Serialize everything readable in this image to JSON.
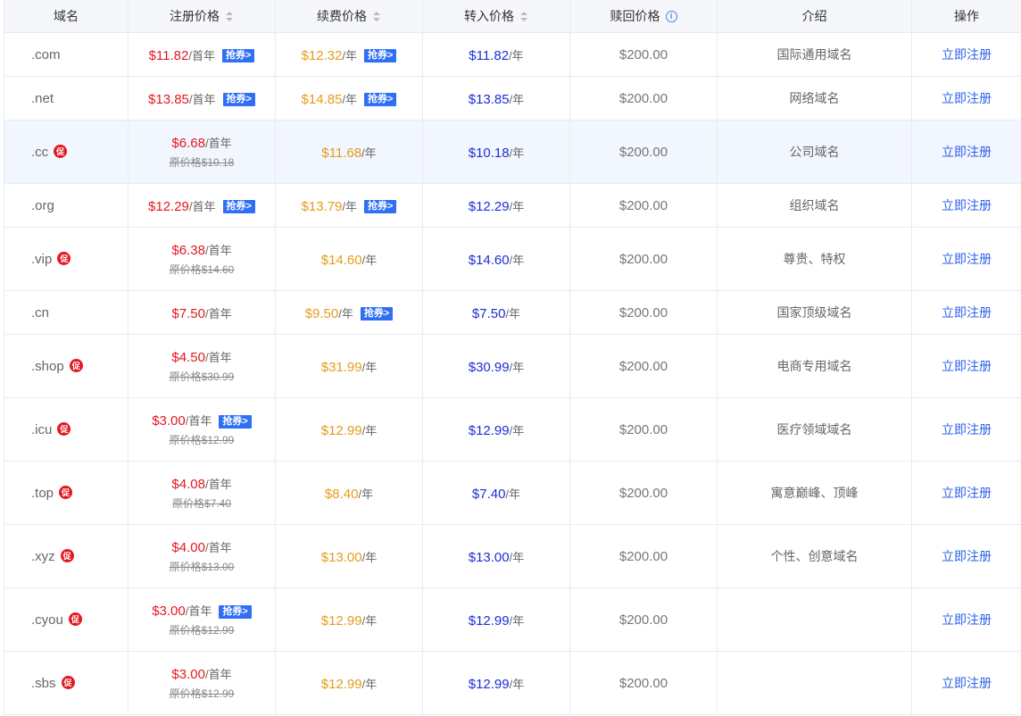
{
  "headers": {
    "domain": "域名",
    "register": "注册价格",
    "renew": "续费价格",
    "transfer": "转入价格",
    "redeem": "赎回价格",
    "intro": "介绍",
    "action": "操作"
  },
  "labels": {
    "first_year": "/首年",
    "per_year": "/年",
    "coupon": "抢券>",
    "promo": "促",
    "action_link": "立即注册"
  },
  "colors": {
    "register_price": "#e4181f",
    "renew_price": "#e69b19",
    "transfer_price": "#1b2fd6",
    "coupon_badge": "#2f6ff3",
    "link": "#2c62e8"
  },
  "rows": [
    {
      "domain": ".com",
      "reg": "$11.82",
      "reg_coupon": "抢券>",
      "renew": "$12.32",
      "renew_coupon": "抢券>",
      "transfer": "$11.82",
      "redeem": "$200.00",
      "intro": "国际通用域名",
      "action": "立即注册"
    },
    {
      "domain": ".net",
      "reg": "$13.85",
      "reg_coupon": "抢券>",
      "renew": "$14.85",
      "renew_coupon": "抢券>",
      "transfer": "$13.85",
      "redeem": "$200.00",
      "intro": "网络域名",
      "action": "立即注册"
    },
    {
      "domain": ".cc",
      "promo": "促",
      "reg": "$6.68",
      "orig": "原价格$10.18",
      "renew": "$11.68",
      "transfer": "$10.18",
      "redeem": "$200.00",
      "intro": "公司域名",
      "action": "立即注册"
    },
    {
      "domain": ".org",
      "reg": "$12.29",
      "reg_coupon": "抢券>",
      "renew": "$13.79",
      "renew_coupon": "抢券>",
      "transfer": "$12.29",
      "redeem": "$200.00",
      "intro": "组织域名",
      "action": "立即注册"
    },
    {
      "domain": ".vip",
      "promo": "促",
      "reg": "$6.38",
      "orig": "原价格$14.60",
      "renew": "$14.60",
      "transfer": "$14.60",
      "redeem": "$200.00",
      "intro": "尊贵、特权",
      "action": "立即注册"
    },
    {
      "domain": ".cn",
      "reg": "$7.50",
      "renew": "$9.50",
      "renew_coupon": "抢券>",
      "transfer": "$7.50",
      "redeem": "$200.00",
      "intro": "国家顶级域名",
      "action": "立即注册"
    },
    {
      "domain": ".shop",
      "promo": "促",
      "reg": "$4.50",
      "orig": "原价格$30.99",
      "renew": "$31.99",
      "transfer": "$30.99",
      "redeem": "$200.00",
      "intro": "电商专用域名",
      "action": "立即注册"
    },
    {
      "domain": ".icu",
      "promo": "促",
      "reg": "$3.00",
      "reg_coupon": "抢券>",
      "orig": "原价格$12.99",
      "renew": "$12.99",
      "transfer": "$12.99",
      "redeem": "$200.00",
      "intro": "医疗领域域名",
      "action": "立即注册"
    },
    {
      "domain": ".top",
      "promo": "促",
      "reg": "$4.08",
      "orig": "原价格$7.40",
      "renew": "$8.40",
      "transfer": "$7.40",
      "redeem": "$200.00",
      "intro": "寓意巅峰、顶峰",
      "action": "立即注册"
    },
    {
      "domain": ".xyz",
      "promo": "促",
      "reg": "$4.00",
      "orig": "原价格$13.00",
      "renew": "$13.00",
      "transfer": "$13.00",
      "redeem": "$200.00",
      "intro": "个性、创意域名",
      "action": "立即注册"
    },
    {
      "domain": ".cyou",
      "promo": "促",
      "reg": "$3.00",
      "reg_coupon": "抢券>",
      "orig": "原价格$12.99",
      "renew": "$12.99",
      "transfer": "$12.99",
      "redeem": "$200.00",
      "intro": "",
      "action": "立即注册"
    },
    {
      "domain": ".sbs",
      "promo": "促",
      "reg": "$3.00",
      "orig": "原价格$12.99",
      "renew": "$12.99",
      "transfer": "$12.99",
      "redeem": "$200.00",
      "intro": "",
      "action": "立即注册"
    }
  ]
}
